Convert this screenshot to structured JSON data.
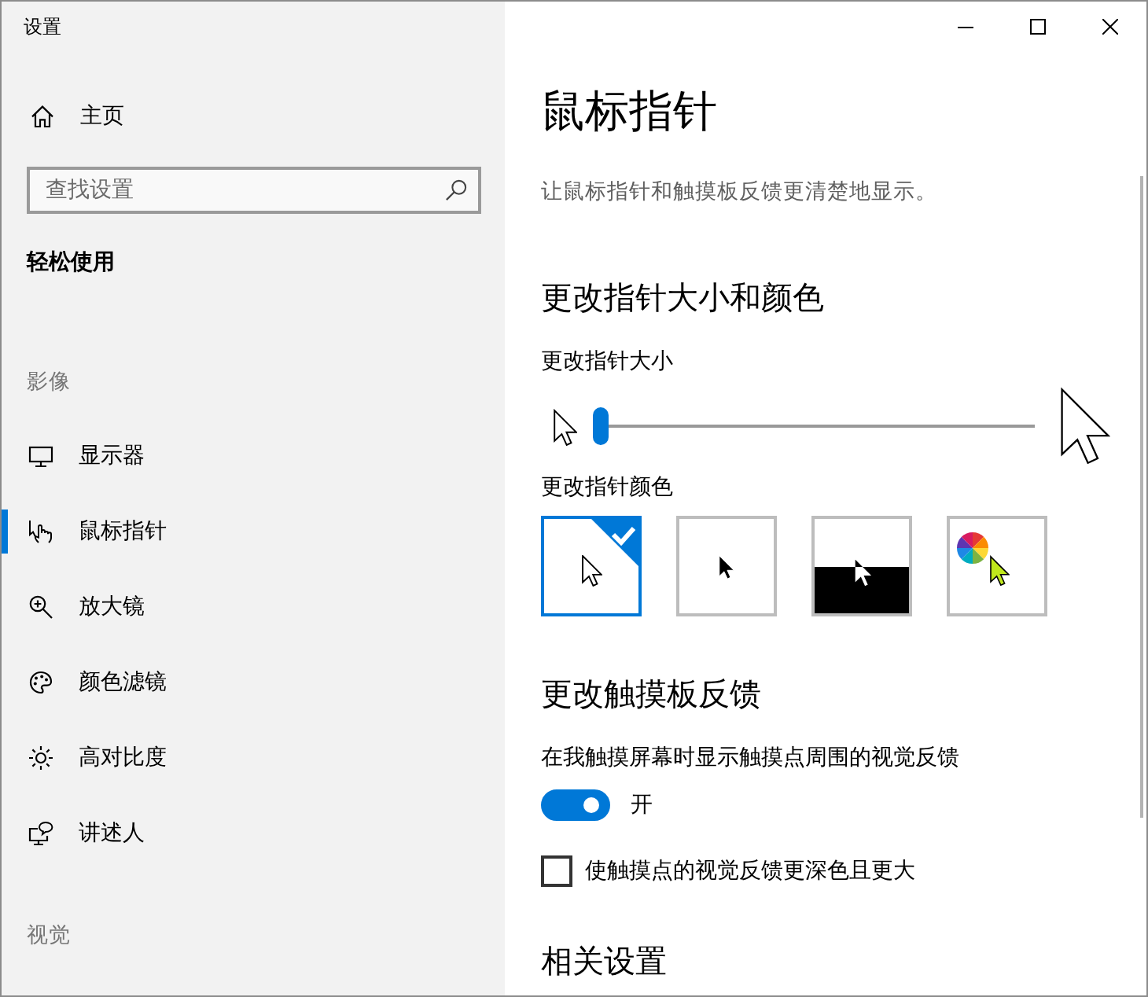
{
  "window": {
    "title": "设置"
  },
  "sidebar": {
    "home": {
      "label": "主页"
    },
    "search": {
      "placeholder": "查找设置"
    },
    "section_title": "轻松使用",
    "groups": [
      {
        "heading": "影像",
        "items": [
          {
            "label": "显示器",
            "selected": false
          },
          {
            "label": "鼠标指针",
            "selected": true
          },
          {
            "label": "放大镜",
            "selected": false
          },
          {
            "label": "颜色滤镜",
            "selected": false
          },
          {
            "label": "高对比度",
            "selected": false
          },
          {
            "label": "讲述人",
            "selected": false
          }
        ]
      },
      {
        "heading": "视觉"
      }
    ]
  },
  "page": {
    "title": "鼠标指针",
    "description": "让鼠标指针和触摸板反馈更清楚地显示。"
  },
  "pointer": {
    "heading": "更改指针大小和颜色",
    "size": {
      "label": "更改指针大小",
      "level": 0
    },
    "color": {
      "label": "更改指针颜色",
      "options": [
        {
          "kind": "light",
          "selected": true
        },
        {
          "kind": "dark",
          "selected": false
        },
        {
          "kind": "inverted",
          "selected": false
        },
        {
          "kind": "custom",
          "selected": false
        }
      ]
    }
  },
  "touch": {
    "heading": "更改触摸板反馈",
    "feedback": {
      "label": "在我触摸屏幕时显示触摸点周围的视觉反馈",
      "on": true,
      "state_text": "开"
    },
    "darker": {
      "label": "使触摸点的视觉反馈更深色且更大",
      "checked": false
    }
  },
  "related": {
    "heading": "相关设置"
  }
}
